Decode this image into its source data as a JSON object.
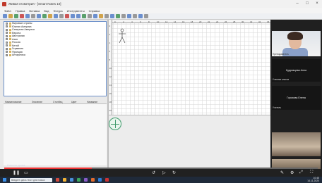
{
  "window": {
    "title": "Живая геометрия - [Smart Notes 10]",
    "controls": [
      "–",
      "□",
      "×"
    ]
  },
  "menu": [
    "Файл",
    "Правка",
    "Вставка",
    "Вид",
    "Фигура",
    "Инструменты",
    "Справка"
  ],
  "toolbar_colors": [
    "#6b8fce",
    "#d1a34a",
    "#5aa06b",
    "#c55",
    "#6b8fce",
    "#999",
    "#6b8fce",
    "#5aa06b",
    "#d1a34a",
    "#6b8fce",
    "#999",
    "#c55",
    "#6b8fce",
    "#6b8fce",
    "#5aa06b",
    "#999",
    "#6b8fce",
    "#d1a34a",
    "#999",
    "#6b8fce",
    "#5aa06b",
    "#999",
    "#6b8fce",
    "#999",
    "#6b8fce",
    "#999"
  ],
  "tree": {
    "items": [
      "Мировые страны",
      "Южная Америка",
      "Северная Америка",
      "Европа",
      "Австралия",
      "Азия",
      "Россия",
      "Китай",
      "Германия",
      "Франция",
      "Антарктика"
    ]
  },
  "props_header": [
    "Наименование",
    "Значение",
    "Столбец",
    "Цвет",
    "Название"
  ],
  "ruler": {
    "top": [
      "0",
      "2",
      "4",
      "6",
      "8",
      "10",
      "12",
      "14",
      "16",
      "18",
      "20",
      "22",
      "24",
      "26",
      "28",
      "30",
      "32",
      "34",
      "36",
      "38"
    ],
    "left": [
      "0",
      "2",
      "4",
      "6",
      "8",
      "10",
      "12",
      "14",
      "16",
      "18",
      "20"
    ]
  },
  "video": {
    "tiles": [
      {
        "kind": "person",
        "name": "Преподаватель"
      },
      {
        "kind": "dark",
        "label": "Кудрявцева Анна",
        "name": "Кудрявцева Анна"
      },
      {
        "kind": "dark",
        "label": "Горохова Елена",
        "name": "Горохова Елена"
      }
    ],
    "name_labels": [
      "Ученики класса",
      "Учитель"
    ]
  },
  "player": {
    "progress": 0.28,
    "caption": "Начало урока"
  },
  "taskbar": {
    "search_placeholder": "Введите здесь текст для поиска",
    "time": "10:45",
    "date": "14.11.2020"
  }
}
